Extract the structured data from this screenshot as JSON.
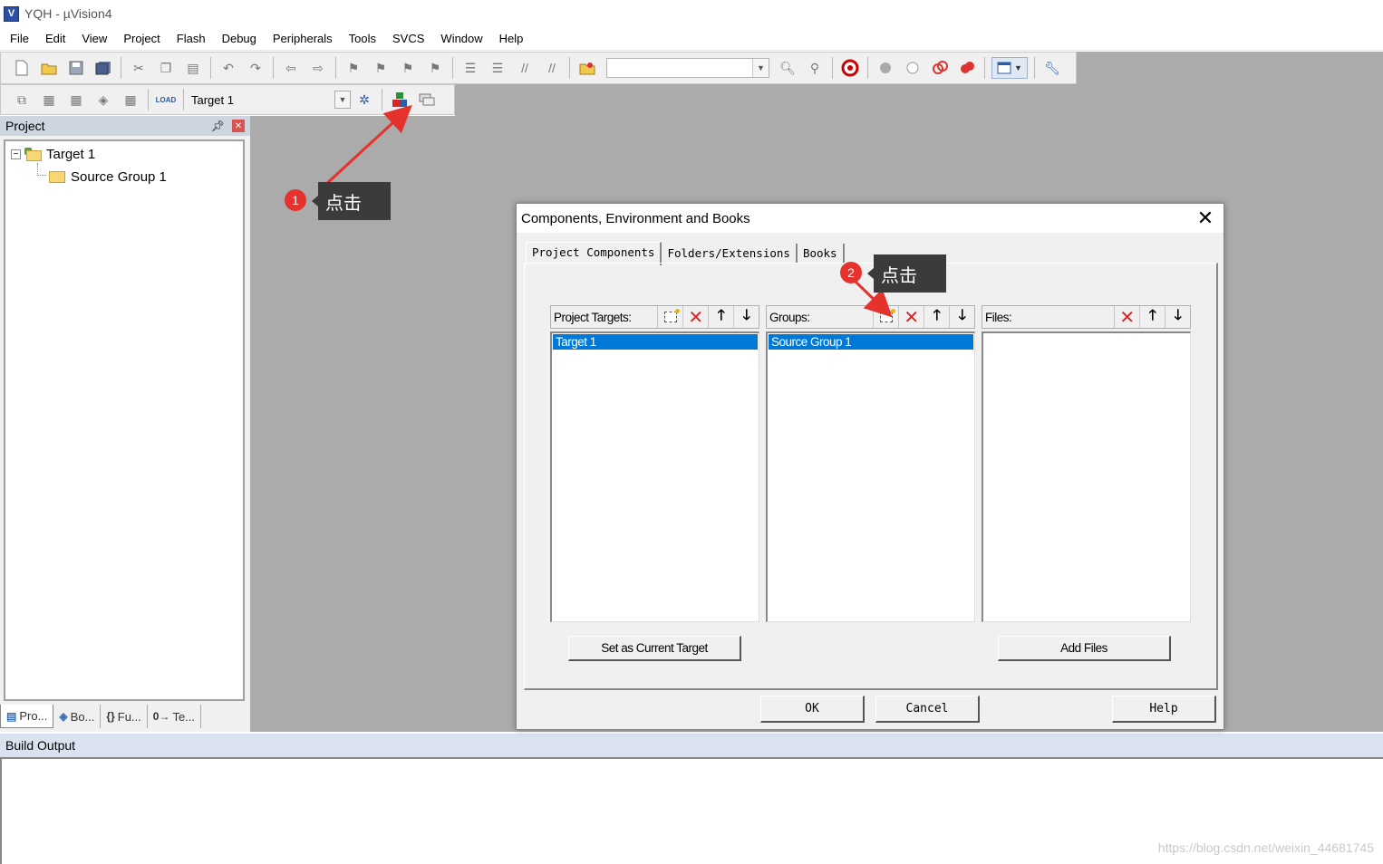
{
  "window": {
    "title": "YQH  - µVision4",
    "app_icon": "V"
  },
  "menu": [
    "File",
    "Edit",
    "View",
    "Project",
    "Flash",
    "Debug",
    "Peripherals",
    "Tools",
    "SVCS",
    "Window",
    "Help"
  ],
  "toolbar2": {
    "target_select": "Target 1"
  },
  "project_pane": {
    "title": "Project",
    "tree": {
      "target": "Target 1",
      "group": "Source Group 1"
    },
    "tabs": [
      "Pro...",
      "Bo...",
      "Fu...",
      "Te..."
    ]
  },
  "build_output": {
    "title": "Build Output"
  },
  "dialog": {
    "title": "Components, Environment and Books",
    "tabs": [
      "Project Components",
      "Folders/Extensions",
      "Books"
    ],
    "targets": {
      "label": "Project Targets:",
      "items": [
        "Target 1"
      ]
    },
    "groups": {
      "label": "Groups:",
      "items": [
        "Source Group 1"
      ]
    },
    "files": {
      "label": "Files:"
    },
    "set_current_target": "Set as Current Target",
    "add_files": "Add Files",
    "ok": "OK",
    "cancel": "Cancel",
    "help": "Help"
  },
  "annotations": [
    {
      "number": "1",
      "text": "点击"
    },
    {
      "number": "2",
      "text": "点击"
    }
  ],
  "watermark": "https://blog.csdn.net/weixin_44681745",
  "colors": {
    "selection": "#0078d7",
    "annotation_red": "#e5322d",
    "callout_bg": "#3b3b3b",
    "workspace": "#ababab"
  }
}
